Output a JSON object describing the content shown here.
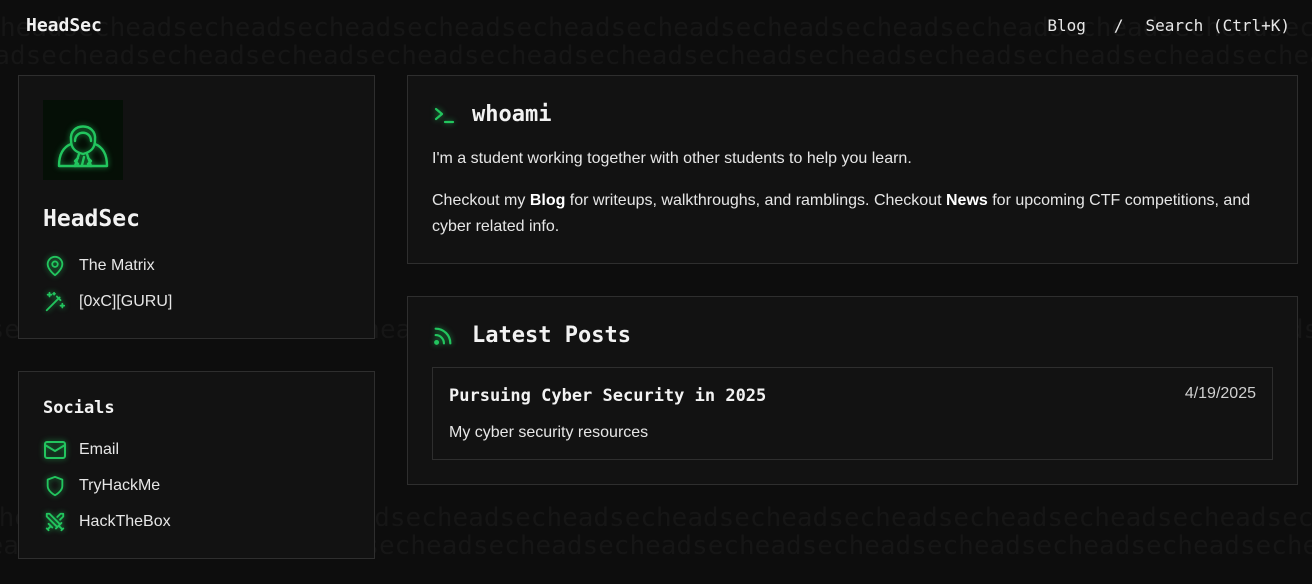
{
  "header": {
    "brand": "HeadSec",
    "nav_blog": "Blog",
    "nav_sep": "/",
    "nav_search": "Search (Ctrl+K)"
  },
  "background_word": "headsec",
  "profile": {
    "name": "HeadSec",
    "location": "The Matrix",
    "rank": "[0xC][GURU]"
  },
  "socials": {
    "title": "Socials",
    "items": [
      {
        "label": "Email",
        "icon": "mail-icon"
      },
      {
        "label": "TryHackMe",
        "icon": "shield-icon"
      },
      {
        "label": "HackTheBox",
        "icon": "swords-icon"
      }
    ]
  },
  "whoami": {
    "title": "whoami",
    "line1": "I'm a student working together with other students to help you learn.",
    "line2_a": "Checkout my ",
    "line2_blog": "Blog",
    "line2_b": " for writeups, walkthroughs, and ramblings. Checkout ",
    "line2_news": "News",
    "line2_c": " for upcoming CTF competitions, and cyber related info."
  },
  "latest": {
    "title": "Latest Posts",
    "posts": [
      {
        "title": "Pursuing Cyber Security in 2025",
        "date": "4/19/2025",
        "description": "My cyber security resources"
      }
    ]
  },
  "colors": {
    "accent": "#22c55e",
    "background": "#0d0d0d",
    "card": "#121212",
    "border": "#2e2e2e"
  }
}
